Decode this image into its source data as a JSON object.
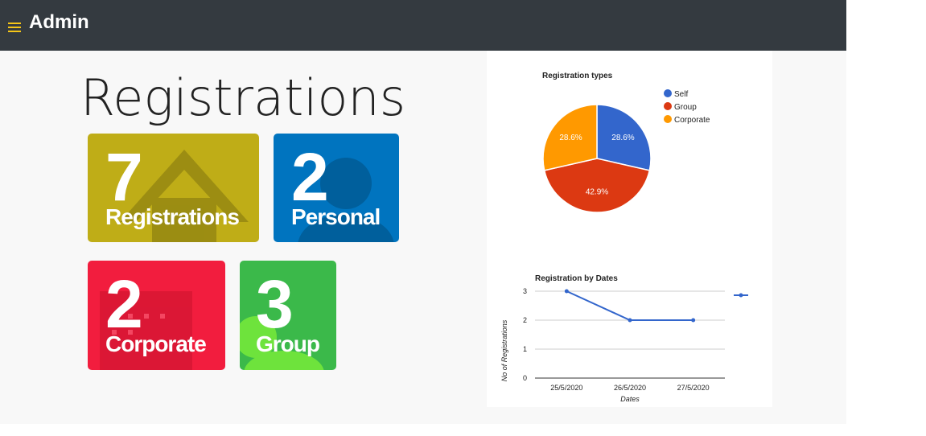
{
  "app": {
    "title": "Admin"
  },
  "page": {
    "title": "Registrations"
  },
  "tiles": [
    {
      "number": "7",
      "label": "Registrations",
      "color": "#bfad17"
    },
    {
      "number": "2",
      "label": "Personal",
      "color": "#0074bf"
    },
    {
      "number": "2",
      "label": "Corporate",
      "color": "#f21d3e"
    },
    {
      "number": "3",
      "label": "Group",
      "color": "#3bb94a"
    }
  ],
  "chart_data": [
    {
      "type": "pie",
      "title": "Registration types",
      "categories": [
        "Self",
        "Group",
        "Corporate"
      ],
      "values": [
        28.6,
        42.9,
        28.6
      ],
      "slice_labels": [
        "28.6%",
        "42.9%",
        "28.6%"
      ],
      "colors": [
        "#3366cc",
        "#dc3912",
        "#ff9900"
      ],
      "legend": "right"
    },
    {
      "type": "line",
      "title": "Registration by Dates",
      "xlabel": "Dates",
      "ylabel": "No of Registrations",
      "categories": [
        "25/5/2020",
        "26/5/2020",
        "27/5/2020"
      ],
      "series": [
        {
          "values": [
            3,
            2,
            2
          ],
          "color": "#3366cc"
        }
      ],
      "yticks": [
        "0",
        "1",
        "2",
        "3"
      ],
      "ylim": [
        0,
        3
      ],
      "grid": true,
      "legend": "right"
    }
  ]
}
